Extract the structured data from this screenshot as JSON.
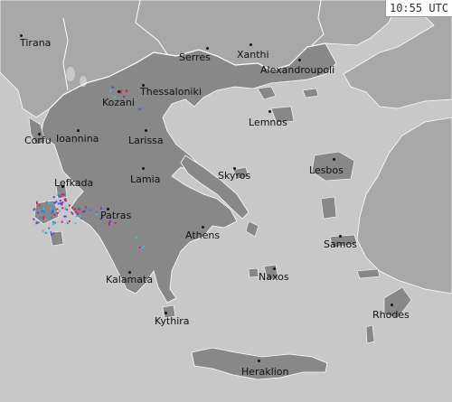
{
  "timestamp": "10:55 UTC",
  "colors": {
    "sea": "#c8c8c8",
    "land_other": "#a8a8a8",
    "land_greece": "#888888",
    "strike_red": "#d0224a",
    "strike_purple": "#7a2ec4",
    "strike_blue": "#3a7be0",
    "strike_cyan": "#3fc0e8"
  },
  "cities": [
    {
      "name": "Tirana"
    },
    {
      "name": "Serres"
    },
    {
      "name": "Xanthi"
    },
    {
      "name": "Alexandroupoli"
    },
    {
      "name": "Thessaloniki"
    },
    {
      "name": "Kozani"
    },
    {
      "name": "Lemnos"
    },
    {
      "name": "Corfu"
    },
    {
      "name": "Ioannina"
    },
    {
      "name": "Larissa"
    },
    {
      "name": "Lesbos"
    },
    {
      "name": "Lamia"
    },
    {
      "name": "Skyros"
    },
    {
      "name": "Lefkada"
    },
    {
      "name": "Patras"
    },
    {
      "name": "Athens"
    },
    {
      "name": "Samos"
    },
    {
      "name": "Kalamata"
    },
    {
      "name": "Naxos"
    },
    {
      "name": "Rhodes"
    },
    {
      "name": "Kythira"
    },
    {
      "name": "Heraklion"
    }
  ]
}
